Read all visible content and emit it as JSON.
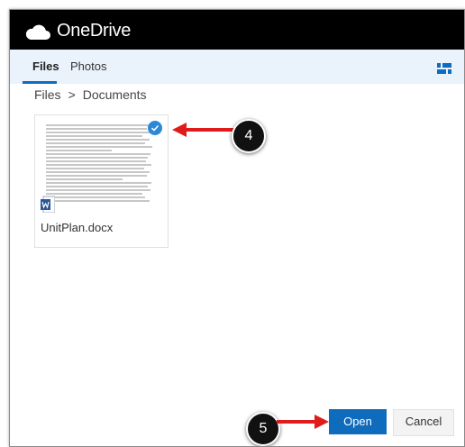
{
  "app": {
    "brand": "OneDrive"
  },
  "tabs": [
    {
      "label": "Files",
      "selected": true
    },
    {
      "label": "Photos",
      "selected": false
    }
  ],
  "breadcrumb": {
    "root": "Files",
    "separator": ">",
    "current": "Documents"
  },
  "file": {
    "name": "UnitPlan.docx",
    "selected": true
  },
  "callouts": {
    "step4": "4",
    "step5": "5"
  },
  "buttons": {
    "open": "Open",
    "cancel": "Cancel"
  },
  "colors": {
    "accent": "#0f6cbd",
    "header": "#000000",
    "tab_bar": "#eaf2fb",
    "annotation_arrow": "#e01b1b"
  },
  "icons": {
    "logo": "cloud-icon",
    "view": "view-toggle-icon",
    "file_type": "word-icon",
    "selected": "checkmark-icon"
  }
}
